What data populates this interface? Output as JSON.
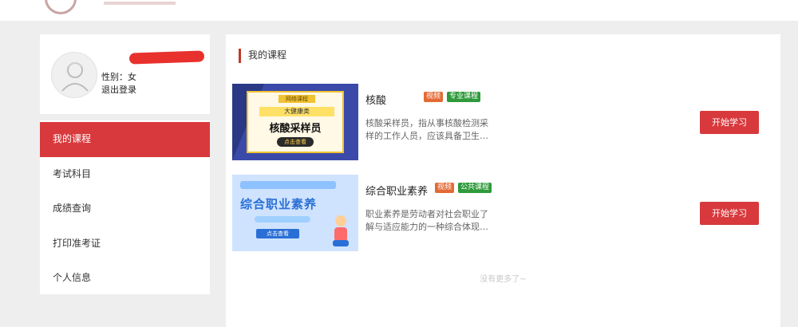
{
  "profile": {
    "gender": "性别：女",
    "logout": "退出登录"
  },
  "menu": {
    "items": [
      {
        "label": "我的课程"
      },
      {
        "label": "考试科目"
      },
      {
        "label": "成绩查询"
      },
      {
        "label": "打印准考证"
      },
      {
        "label": "个人信息"
      }
    ]
  },
  "main": {
    "section_title": "我的课程",
    "courses": [
      {
        "title": "核酸",
        "tags": [
          "视频",
          "专业课程"
        ],
        "description": "核酸采样员，指从事核酸检测采样的工作人员，应该具备卫生…",
        "button": "开始学习",
        "thumb": {
          "header": "网络课程",
          "yellow": "大健康类",
          "main": "核酸采样员",
          "button": "点击查看"
        }
      },
      {
        "title": "综合职业素养",
        "tags": [
          "视频",
          "公共课程"
        ],
        "description": "职业素养是劳动者对社会职业了解与适应能力的一种综合体现…",
        "button": "开始学习",
        "thumb": {
          "main": "综合职业素养",
          "button": "点击查看"
        }
      }
    ],
    "no_more": "没有更多了~"
  },
  "colors": {
    "accent": "#d8393c",
    "tag_video": "#e36a35",
    "tag_course": "#2f9a3b"
  }
}
